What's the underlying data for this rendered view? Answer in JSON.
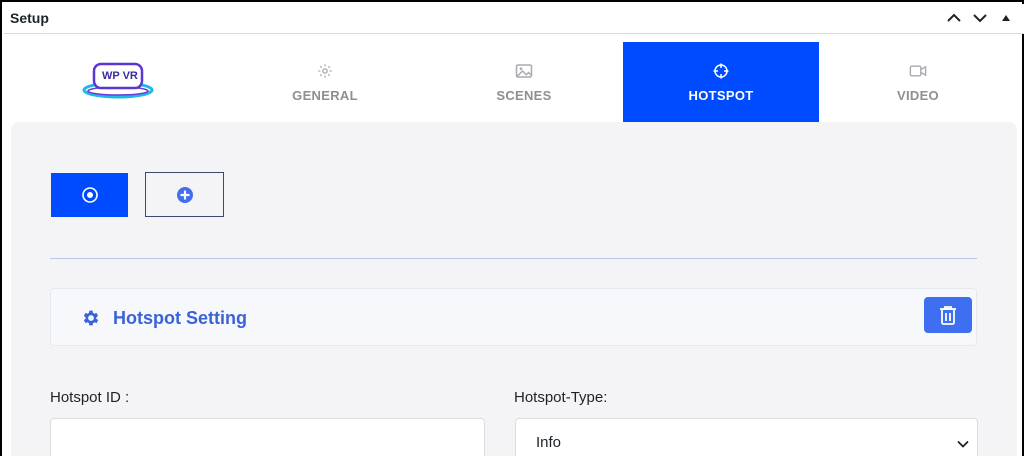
{
  "window": {
    "title": "Setup"
  },
  "logo": {
    "text": "WP VR"
  },
  "tabs": [
    {
      "label": "GENERAL",
      "icon": "gear-icon",
      "active": false
    },
    {
      "label": "SCENES",
      "icon": "image-icon",
      "active": false
    },
    {
      "label": "HOTSPOT",
      "icon": "crosshair-icon",
      "active": true
    },
    {
      "label": "VIDEO",
      "icon": "video-icon",
      "active": false
    }
  ],
  "hotspot_setting": {
    "title": "Hotspot Setting"
  },
  "fields": {
    "hotspot_id": {
      "label": "Hotspot ID :",
      "value": "",
      "placeholder": ""
    },
    "hotspot_type": {
      "label": "Hotspot-Type:",
      "value": "Info"
    }
  },
  "colors": {
    "accent": "#004bff",
    "setting_title": "#3a63d7",
    "delete_button": "#3d6ff0",
    "panel_bg": "#f4f4f7"
  }
}
